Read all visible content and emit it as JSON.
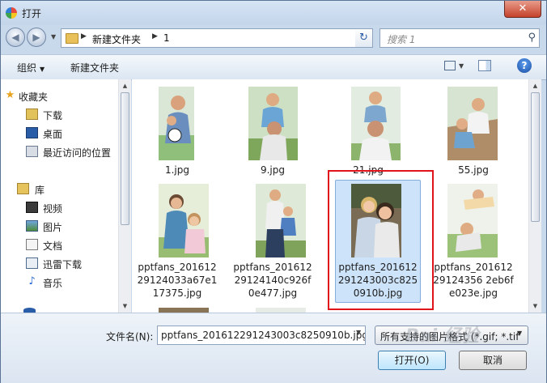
{
  "window": {
    "title": "打开",
    "close_glyph": "✕"
  },
  "nav": {
    "back_glyph": "◀",
    "forward_glyph": "▶",
    "breadcrumbs": [
      "新建文件夹",
      "1"
    ],
    "refresh_glyph": "↻",
    "search_placeholder": "搜索 1",
    "search_icon": "⚲"
  },
  "toolbar": {
    "organize_label": "组织",
    "new_folder_label": "新建文件夹",
    "help_glyph": "?"
  },
  "sidebar": {
    "favorites_label": "收藏夹",
    "favorites": [
      {
        "label": "下载",
        "icon": "download-folder-icon"
      },
      {
        "label": "桌面",
        "icon": "desktop-icon"
      },
      {
        "label": "最近访问的位置",
        "icon": "recent-places-icon"
      }
    ],
    "libraries_label": "库",
    "libraries": [
      {
        "label": "视频",
        "icon": "video-library-icon"
      },
      {
        "label": "图片",
        "icon": "picture-library-icon"
      },
      {
        "label": "文档",
        "icon": "document-library-icon"
      },
      {
        "label": "迅雷下载",
        "icon": "xunlei-library-icon"
      },
      {
        "label": "音乐",
        "icon": "music-library-icon"
      }
    ]
  },
  "files": [
    {
      "name": "1.jpg",
      "selected": false
    },
    {
      "name": "9.jpg",
      "selected": false
    },
    {
      "name": "21.jpg",
      "selected": false
    },
    {
      "name": "55.jpg",
      "selected": false
    },
    {
      "name": "pptfans_20161229124033a67e117375.jpg",
      "display": [
        "pptfans_201612",
        "29124033a67e1",
        "17375.jpg"
      ],
      "selected": false
    },
    {
      "name": "pptfans_20161229124140c926f0e477.jpg",
      "display": [
        "pptfans_201612",
        "29124140c926f",
        "0e477.jpg"
      ],
      "selected": false
    },
    {
      "name": "pptfans_201612291243003c8250910b.jpg",
      "display": [
        "pptfans_201612",
        "291243003c825",
        "0910b.jpg"
      ],
      "selected": true
    },
    {
      "name": "pptfans_20161229124356 2eb6fe023e.jpg",
      "display": [
        "pptfans_201612",
        "29124356 2eb6f",
        "e023e.jpg"
      ],
      "selected": false
    }
  ],
  "bottom": {
    "filename_label": "文件名(N):",
    "filename_value": "pptfans_201612291243003c8250910b.jpg",
    "filter_value": "所有支持的图片格式 (*.gif; *.tif",
    "open_label": "打开(O)",
    "cancel_label": "取消"
  },
  "watermark": "Bai 经验",
  "colors": {
    "selection": "#cde3fa",
    "highlight_box": "#e0141b"
  }
}
